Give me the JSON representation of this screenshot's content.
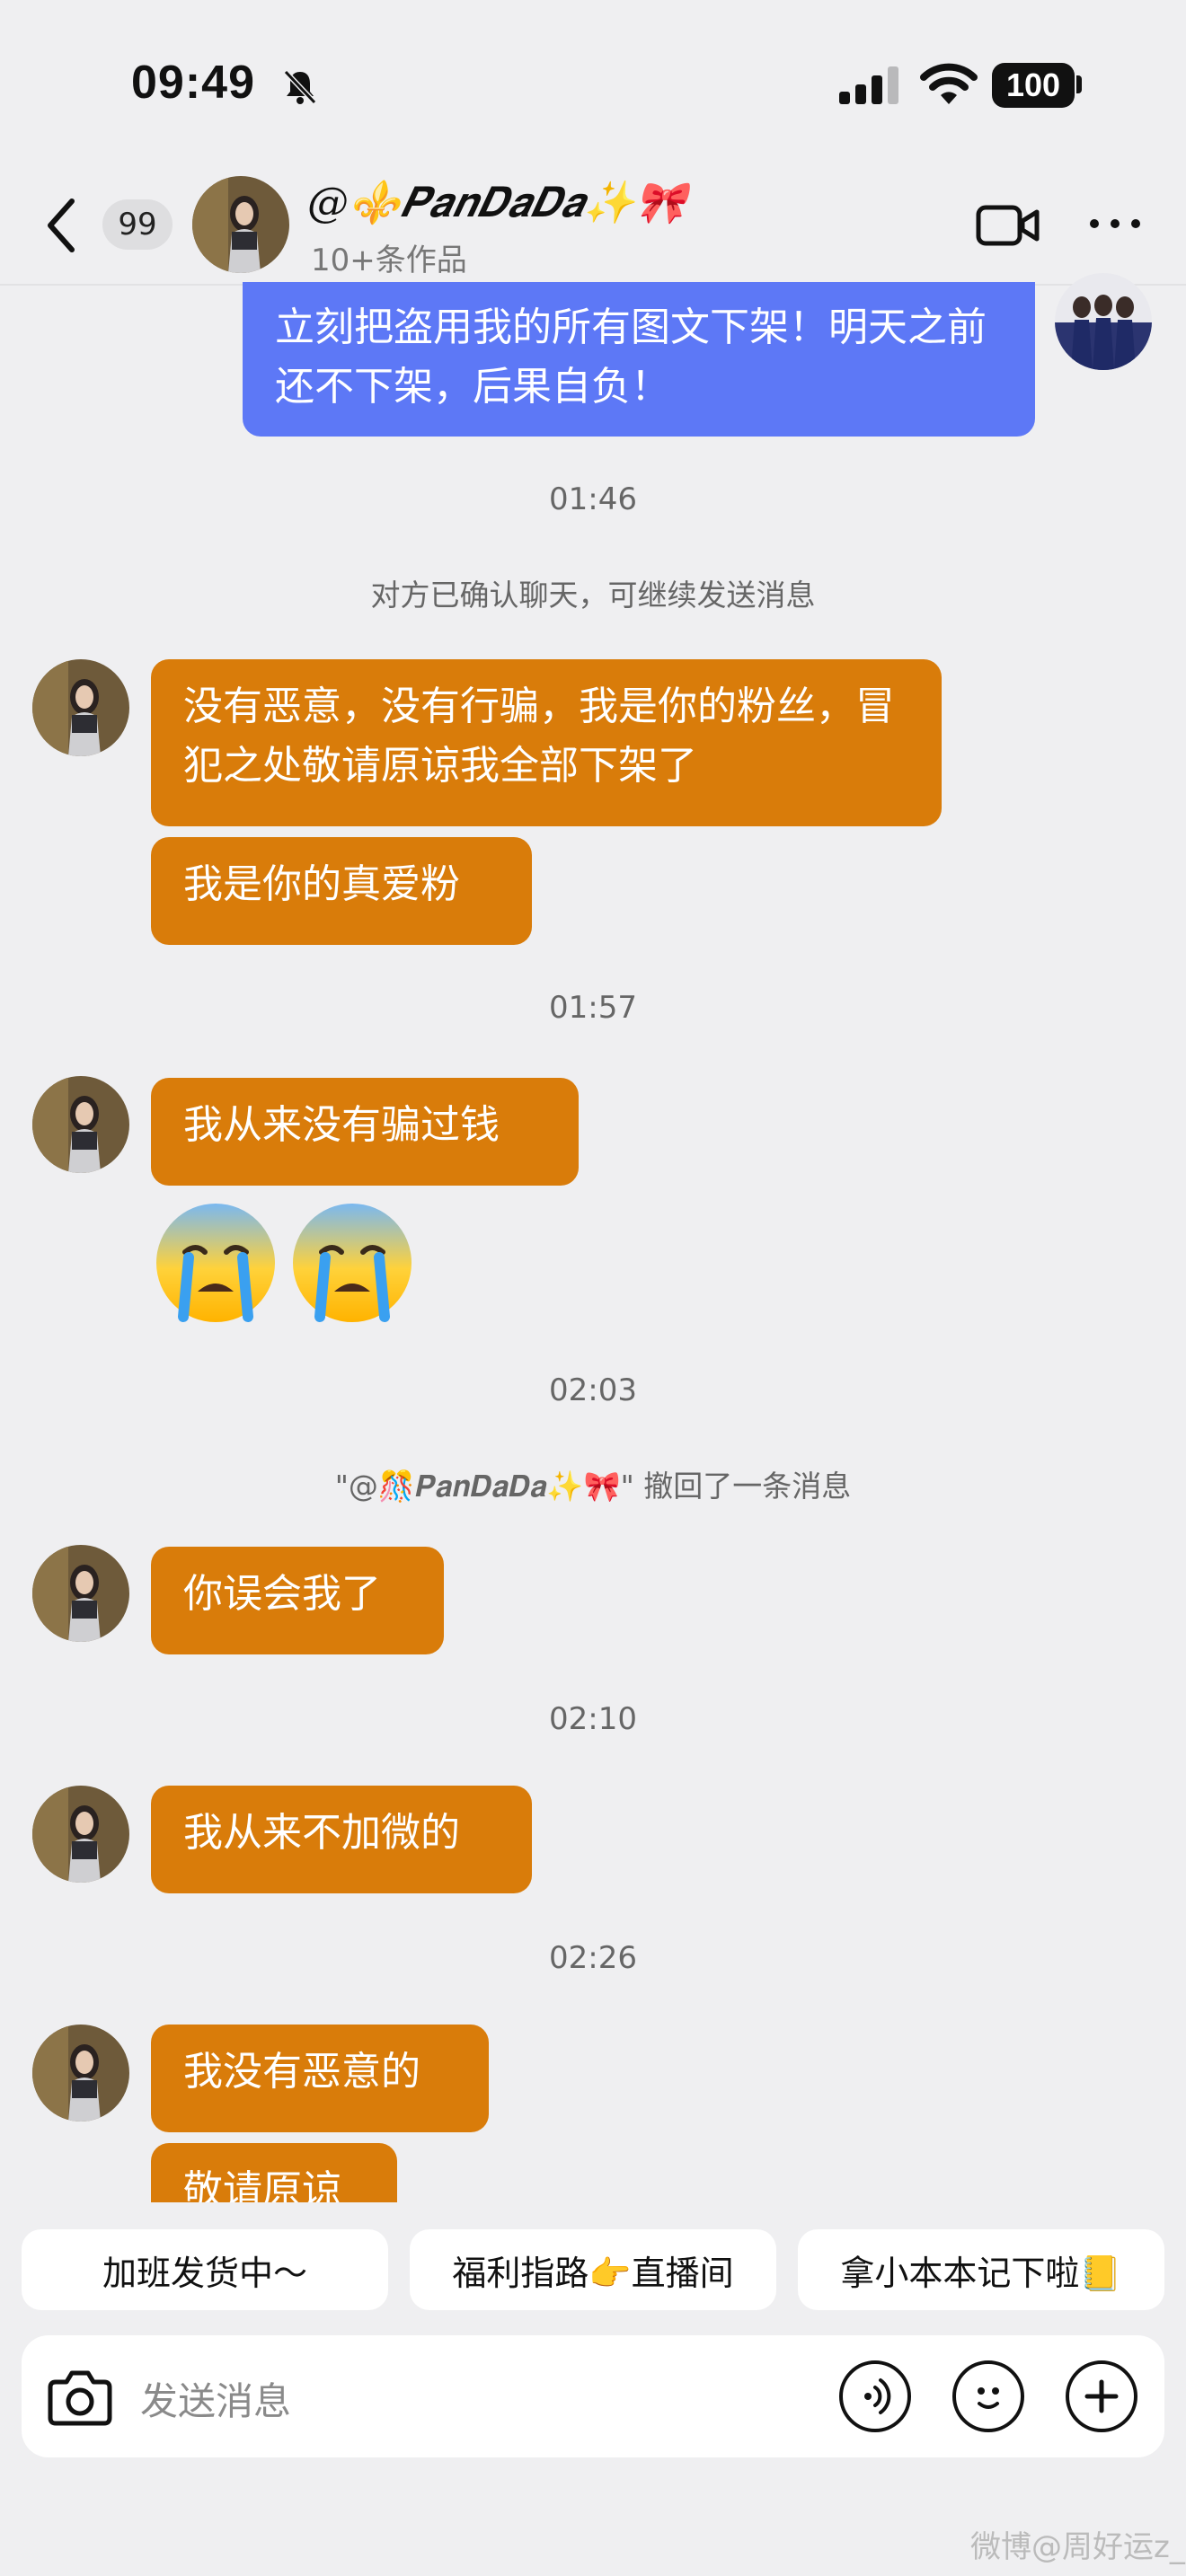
{
  "status_bar": {
    "time": "09:49",
    "battery": "100"
  },
  "header": {
    "unread_count": "99",
    "contact_name": "@⚜️𝑷𝒂𝒏𝑫𝒂𝑫𝒂✨🎀",
    "subtitle": "10+条作品"
  },
  "messages": {
    "m1": "立刻把盗用我的所有图文下架！明天之前还不下架，后果自负！",
    "ts1": "01:46",
    "sys1": "对方已确认聊天，可继续发送消息",
    "m2": "没有恶意，没有行骗，我是你的粉丝，冒犯之处敬请原谅我全部下架了",
    "m3": "我是你的真爱粉",
    "ts2": "01:57",
    "m4": "我从来没有骗过钱",
    "ts3": "02:03",
    "sys2": "\"@🎊𝑷𝒂𝒏𝑫𝒂𝑫𝒂✨🎀\" 撤回了一条消息",
    "m5": "你误会我了",
    "ts4": "02:10",
    "m6": "我从来不加微的",
    "ts5": "02:26",
    "m7": "我没有恶意的",
    "m8": "敬请原谅"
  },
  "quick_replies": [
    "加班发货中～",
    "福利指路👉直播间",
    "拿小本本记下啦📒"
  ],
  "input": {
    "placeholder": "发送消息"
  },
  "watermark": "微博@周好运z_",
  "icons": {
    "status": [
      "bell-muted-icon",
      "signal-icon",
      "wifi-icon"
    ],
    "header": [
      "back-arrow-icon",
      "video-call-icon",
      "more-icon"
    ],
    "input": [
      "camera-icon",
      "voice-icon",
      "emoji-icon",
      "plus-icon"
    ]
  },
  "colors": {
    "incoming_bubble": "#d97c0a",
    "outgoing_bubble": "#5d78f6",
    "background": "#efeff1"
  }
}
